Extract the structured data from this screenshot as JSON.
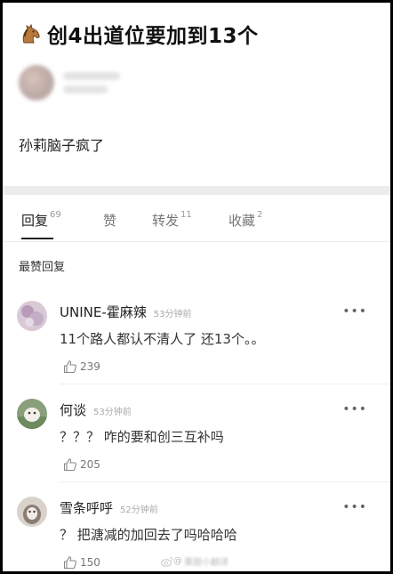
{
  "post": {
    "title": "创4出道位要加到13个",
    "title_icon": "horse-icon",
    "text": "孙莉脑子疯了"
  },
  "tabs": [
    {
      "label": "回复",
      "count": "69",
      "active": true
    },
    {
      "label": "赞",
      "count": "",
      "active": false
    },
    {
      "label": "转发",
      "count": "11",
      "active": false
    },
    {
      "label": "收藏",
      "count": "2",
      "active": false
    }
  ],
  "section_label": "最赞回复",
  "comments": [
    {
      "name": "UNINE-霍麻辣",
      "time": "53分钟前",
      "text": "11个路人都认不清人了 还13个。。",
      "likes": "239",
      "more": "•••"
    },
    {
      "name": "何谈",
      "time": "53分钟前",
      "text": "？？？ 咋的要和创三互补吗",
      "likes": "205",
      "more": "•••"
    },
    {
      "name": "雪条呼呼",
      "time": "52分钟前",
      "text": "？ 把溏减的加回去了吗哈哈哈",
      "likes": "150",
      "more": "•••"
    }
  ],
  "watermark": {
    "prefix": "@",
    "text": "粟甜小翻译"
  },
  "colors": {
    "background_frame": "#000000",
    "tab_active": "#222222",
    "divider": "#ececec"
  }
}
